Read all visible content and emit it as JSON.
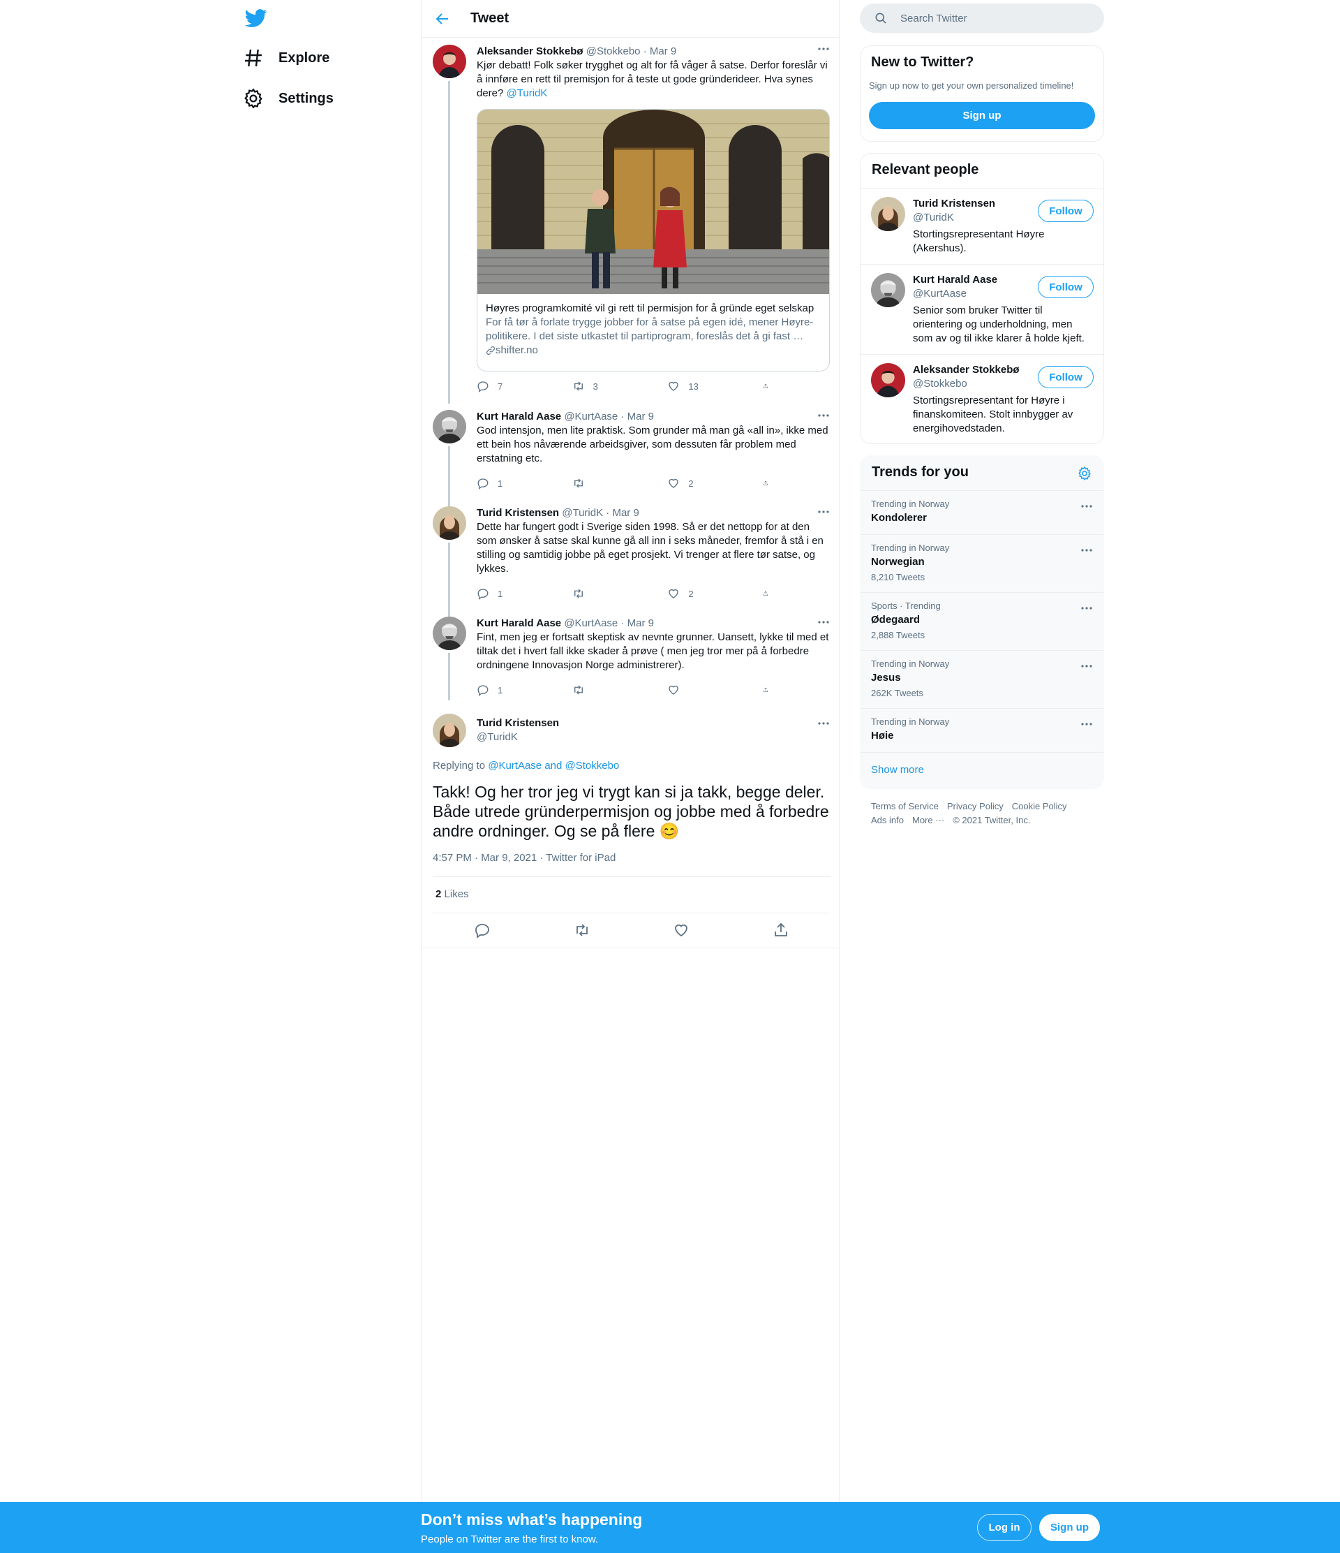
{
  "nav": {
    "explore_label": "Explore",
    "settings_label": "Settings"
  },
  "header": {
    "title": "Tweet"
  },
  "thread": [
    {
      "name": "Aleksander Stokkebø",
      "handle": "@Stokkebo",
      "date": "Mar 9",
      "text": "Kjør debatt! Folk søker trygghet og alt for få våger å satse. Derfor foreslår vi å innføre en rett til premisjon for å teste ut gode gründerideer. Hva synes dere?",
      "mention": "@TuridK",
      "card": {
        "title": "Høyres programkomité vil gi rett til permisjon for å gründe eget selskap",
        "description": "For få tør å forlate trygge jobber for å satse på egen idé, mener Høyre-politikere. I det siste utkastet til partiprogram, foreslås det å gi fast …",
        "domain": "shifter.no"
      },
      "replies": "7",
      "retweets": "3",
      "likes": "13"
    },
    {
      "name": "Kurt Harald Aase",
      "handle": "@KurtAase",
      "date": "Mar 9",
      "text": "God intensjon, men lite praktisk. Som grunder må man gå «all in», ikke med ett bein hos nåværende arbeidsgiver, som dessuten får problem med erstatning etc.",
      "replies": "1",
      "retweets": "",
      "likes": "2"
    },
    {
      "name": "Turid Kristensen",
      "handle": "@TuridK",
      "date": "Mar 9",
      "text": "Dette har fungert godt i Sverige siden 1998. Så er det nettopp for at den som ønsker å satse skal kunne gå all inn i seks måneder, fremfor å stå i en stilling og samtidig jobbe på eget prosjekt. Vi trenger at flere tør satse, og lykkes.",
      "replies": "1",
      "retweets": "",
      "likes": "2"
    },
    {
      "name": "Kurt Harald Aase",
      "handle": "@KurtAase",
      "date": "Mar 9",
      "text": "Fint, men jeg er fortsatt skeptisk av nevnte grunner. Uansett, lykke til med et tiltak det i hvert fall ikke skader å prøve ( men jeg tror mer på å forbedre ordningene Innovasjon Norge administrerer).",
      "replies": "1",
      "retweets": "",
      "likes": ""
    }
  ],
  "main_tweet": {
    "name": "Turid Kristensen",
    "handle": "@TuridK",
    "replying_prefix": "Replying to",
    "replying_to": "@KurtAase and @Stokkebo",
    "text": "Takk! Og her tror jeg vi trygt kan si ja takk, begge deler. Både utrede gründerpermisjon og jobbe med å forbedre andre ordninger. Og se på flere 😊",
    "timestamp": "4:57 PM · Mar 9, 2021 · Twitter for iPad",
    "likes_count": "2",
    "likes_label": "Likes"
  },
  "search": {
    "placeholder": "Search Twitter"
  },
  "new_to_twitter": {
    "title": "New to Twitter?",
    "subtitle": "Sign up now to get your own personalized timeline!",
    "button": "Sign up"
  },
  "relevant_people": {
    "title": "Relevant people",
    "follow_label": "Follow",
    "people": [
      {
        "name": "Turid Kristensen",
        "handle": "@TuridK",
        "bio": "Stortingsrepresentant Høyre (Akershus)."
      },
      {
        "name": "Kurt Harald Aase",
        "handle": "@KurtAase",
        "bio": "Senior som bruker Twitter til orientering og underholdning, men som av og til ikke klarer å holde kjeft."
      },
      {
        "name": "Aleksander Stokkebø",
        "handle": "@Stokkebo",
        "bio": "Stortingsrepresentant for Høyre i finanskomiteen. Stolt innbygger av energihovedstaden."
      }
    ]
  },
  "trends": {
    "title": "Trends for you",
    "items": [
      {
        "category": "Trending in Norway",
        "name": "Kondolerer",
        "count": ""
      },
      {
        "category": "Trending in Norway",
        "name": "Norwegian",
        "count": "8,210 Tweets"
      },
      {
        "category": "Sports · Trending",
        "name": "Ødegaard",
        "count": "2,888 Tweets"
      },
      {
        "category": "Trending in Norway",
        "name": "Jesus",
        "count": "262K Tweets"
      },
      {
        "category": "Trending in Norway",
        "name": "Høie",
        "count": ""
      }
    ],
    "show_more": "Show more"
  },
  "footer": {
    "terms": "Terms of Service",
    "privacy": "Privacy Policy",
    "cookie": "Cookie Policy",
    "ads": "Ads info",
    "more": "More ···",
    "copyright": "© 2021 Twitter, Inc."
  },
  "bottom_bar": {
    "title": "Don’t miss what’s happening",
    "subtitle": "People on Twitter are the first to know.",
    "login": "Log in",
    "signup": "Sign up"
  },
  "colors": {
    "brand": "#1da1f2",
    "link": "#1b95e0",
    "secondary_text": "#5b7083"
  }
}
